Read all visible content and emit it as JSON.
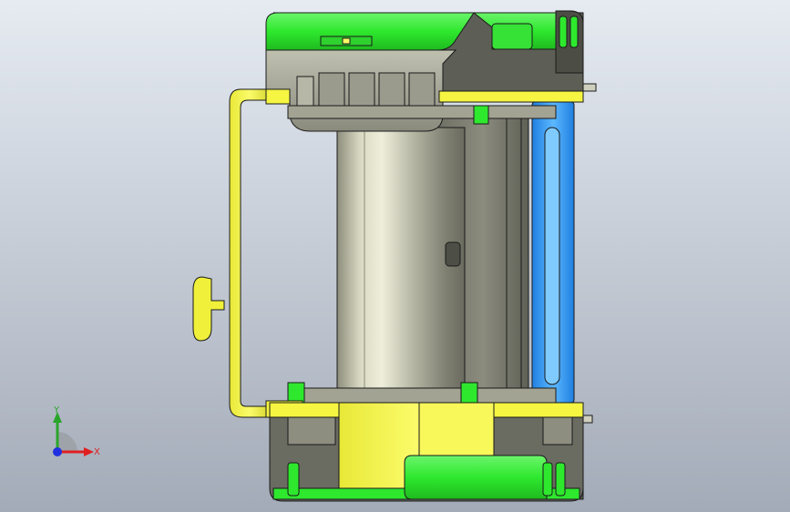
{
  "viewport": {
    "background_top": "#e6ebf2",
    "background_bottom": "#a3abb8"
  },
  "colors": {
    "green": "#2ee82e",
    "green_dark": "#1aa81a",
    "yellow": "#f5f542",
    "yellow_dark": "#c9c930",
    "gray_body": "#a8a99a",
    "gray_dark": "#55564d",
    "cylinder_light": "#e2e2c8",
    "blue": "#3aa3ff",
    "outline": "#1a1a1a",
    "axis_x": "#e02020",
    "axis_y": "#2aa52a",
    "axis_z": "#2030e0"
  },
  "triad": {
    "x_label": "X",
    "y_label": "Y"
  },
  "model": {
    "icon": "cad-assembly-icon"
  }
}
